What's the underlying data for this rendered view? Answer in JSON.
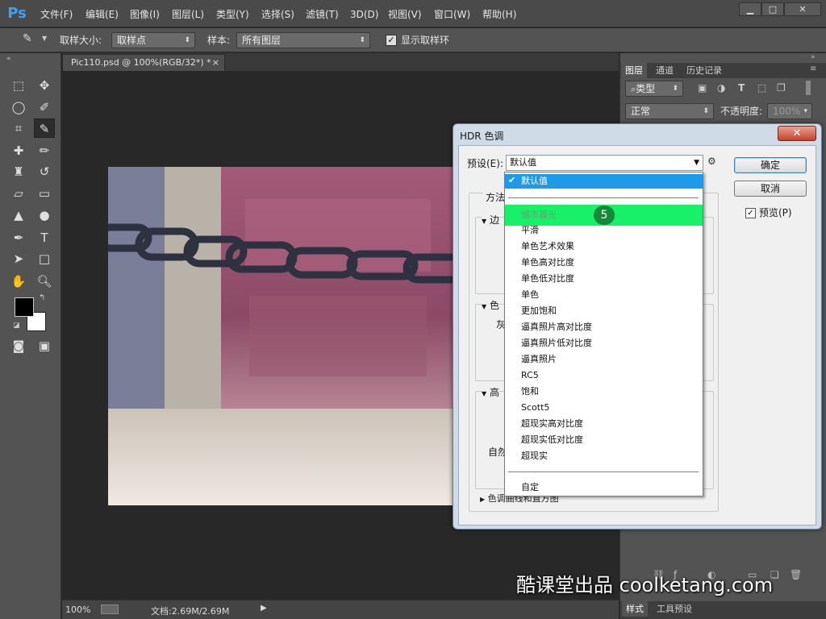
{
  "app": {
    "logo": "Ps"
  },
  "menu": [
    "文件(F)",
    "编辑(E)",
    "图像(I)",
    "图层(L)",
    "类型(Y)",
    "选择(S)",
    "滤镜(T)",
    "3D(D)",
    "视图(V)",
    "窗口(W)",
    "帮助(H)"
  ],
  "window_controls": {
    "minimize": "▁",
    "restore": "□",
    "close": "✕"
  },
  "options": {
    "sample_size_label": "取样大小:",
    "sample_size_value": "取样点",
    "sample_label": "样本:",
    "sample_value": "所有图层",
    "show_ring_label": "显示取样环",
    "show_ring_checked": true
  },
  "document": {
    "tab_title": "Pic110.psd @ 100%(RGB/32*) *",
    "tab_close": "×"
  },
  "status": {
    "zoom": "100%",
    "doc_info": "文档:2.69M/2.69M"
  },
  "panels": {
    "tabs": [
      "图层",
      "通道",
      "历史记录"
    ],
    "kind_filter": "类型",
    "blend_mode": "正常",
    "opacity_label": "不透明度:",
    "opacity_value": "100%",
    "bottom_tabs": [
      "样式",
      "工具预设"
    ]
  },
  "dialog": {
    "title": "HDR 色调",
    "close": "✕",
    "preset_label": "预设(E):",
    "preset_value": "默认值",
    "ok": "确定",
    "cancel": "取消",
    "preview_label": "预览(P)",
    "preview_checked": true,
    "method_label": "方法",
    "group1": "边",
    "group2": "色",
    "group2_sub": "灰",
    "group3": "高",
    "natural_label": "自然",
    "curve_label": "色调曲线和直方图"
  },
  "dropdown": {
    "selected": "默认值",
    "highlighted": "城市暮光",
    "items": [
      "平滑",
      "单色艺术效果",
      "单色高对比度",
      "单色低对比度",
      "单色",
      "更加饱和",
      "逼真照片高对比度",
      "逼真照片低对比度",
      "逼真照片",
      "RC5",
      "饱和",
      "Scott5",
      "超现实高对比度",
      "超现实低对比度",
      "超现实"
    ],
    "custom": "自定",
    "step_badge": "5"
  },
  "watermark": "酷课堂出品 coolketang.com",
  "colors": {
    "highlight_green": "#19f06a",
    "select_blue": "#1e9be8",
    "badge_green": "#138a3a"
  }
}
